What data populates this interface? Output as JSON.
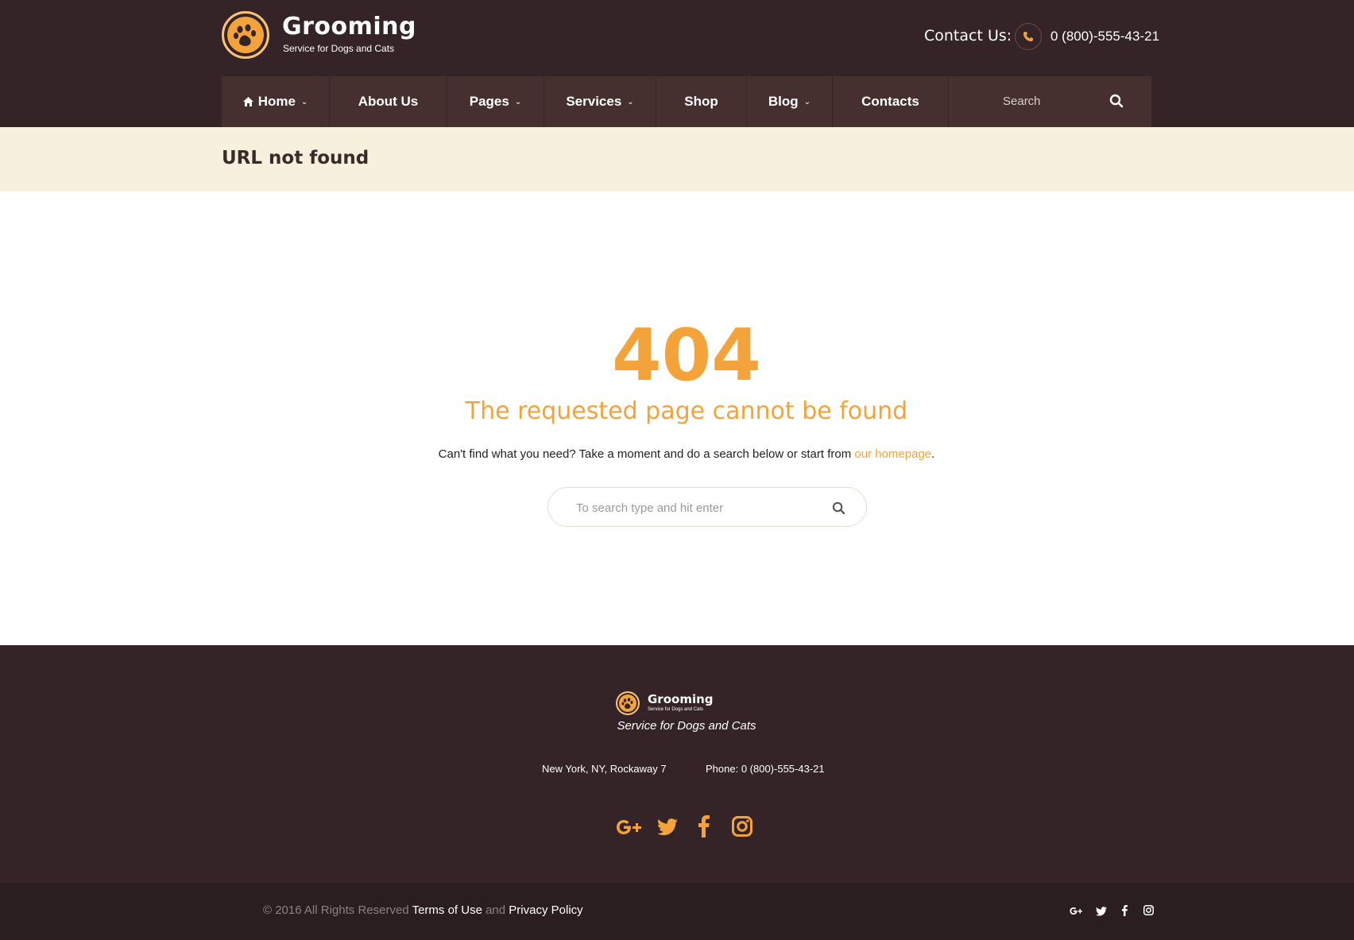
{
  "brand": {
    "name": "Grooming",
    "tagline": "Service for Dogs and Cats"
  },
  "contact": {
    "label": "Contact Us:",
    "phone": "0 (800)-555-43-21"
  },
  "nav": {
    "items": [
      {
        "label": "Home",
        "dropdown": true
      },
      {
        "label": "About Us",
        "dropdown": false
      },
      {
        "label": "Pages",
        "dropdown": true
      },
      {
        "label": "Services",
        "dropdown": true
      },
      {
        "label": "Shop",
        "dropdown": false
      },
      {
        "label": "Blog",
        "dropdown": true
      },
      {
        "label": "Contacts",
        "dropdown": false
      }
    ],
    "search_placeholder": "Search"
  },
  "page_title": "URL not found",
  "error": {
    "code": "404",
    "title": "The requested page cannot be found",
    "text_before": "Can't find what you need? Take a moment and do a search below or start from ",
    "link": "our homepage",
    "text_after": ".",
    "search_placeholder": "To search type and hit enter"
  },
  "footer": {
    "tagline": "Service for Dogs and Cats",
    "address": "New York, NY, Rockaway 7",
    "phone": "Phone: 0 (800)-555-43-21",
    "social": [
      "google-plus-icon",
      "twitter-icon",
      "facebook-icon",
      "instagram-icon"
    ]
  },
  "bottom": {
    "copyright": "© 2016 All Rights Reserved",
    "terms": "Terms of Use",
    "and": "and",
    "privacy": "Privacy Policy"
  },
  "colors": {
    "accent": "#f4a33b",
    "header_bg": "#342428",
    "nav_bg": "#45302f",
    "title_bar_bg": "#f7f0dc",
    "bottom_bg": "#2b1e21"
  }
}
